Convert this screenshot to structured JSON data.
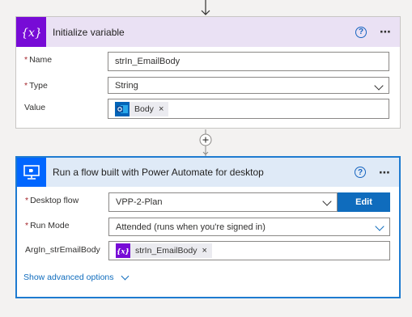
{
  "card1": {
    "title": "Initialize variable",
    "icon": "variable-icon",
    "help": "?",
    "more": "⋯",
    "fields": {
      "name_label": "Name",
      "name_value": "strIn_EmailBody",
      "type_label": "Type",
      "type_value": "String",
      "value_label": "Value",
      "value_token": "Body",
      "value_token_icon": "outlook-icon"
    }
  },
  "card2": {
    "title": "Run a flow built with Power Automate for desktop",
    "icon": "desktop-flow-icon",
    "help": "?",
    "more": "⋯",
    "fields": {
      "desktop_flow_label": "Desktop flow",
      "desktop_flow_value": "VPP-2-Plan",
      "edit_label": "Edit",
      "run_mode_label": "Run Mode",
      "run_mode_value": "Attended (runs when you're signed in)",
      "arg_label": "ArgIn_strEmailBody",
      "arg_token": "strIn_EmailBody",
      "arg_token_icon": "variable-icon"
    },
    "advanced": "Show advanced options"
  },
  "required_mark": "*",
  "token_close": "×",
  "colors": {
    "variable_purple": "#770bd6",
    "desktop_blue": "#0066ff",
    "accent": "#0f6cbd"
  }
}
